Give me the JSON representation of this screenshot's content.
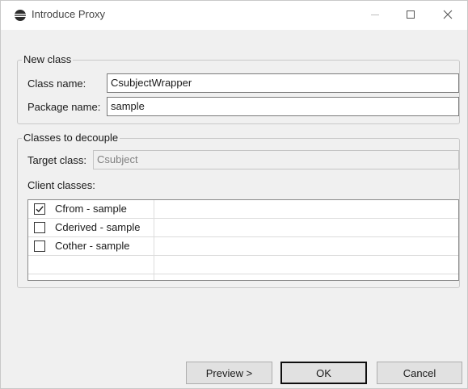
{
  "window": {
    "title": "Introduce Proxy",
    "icon": "eclipse-icon",
    "controls": [
      "minimize-icon",
      "maximize-icon",
      "close-icon"
    ]
  },
  "new_class": {
    "legend": "New class",
    "class_name_label": "Class name:",
    "class_name_value": "CsubjectWrapper",
    "package_name_label": "Package name:",
    "package_name_value": "sample"
  },
  "decouple": {
    "legend": "Classes to decouple",
    "target_class_label": "Target class:",
    "target_class_value": "Csubject",
    "client_classes_label": "Client classes:",
    "client_classes": [
      {
        "label": "Cfrom - sample",
        "checked": true
      },
      {
        "label": "Cderived - sample",
        "checked": false
      },
      {
        "label": "Cother - sample",
        "checked": false
      }
    ]
  },
  "buttons": {
    "preview": "Preview >",
    "ok": "OK",
    "cancel": "Cancel"
  }
}
